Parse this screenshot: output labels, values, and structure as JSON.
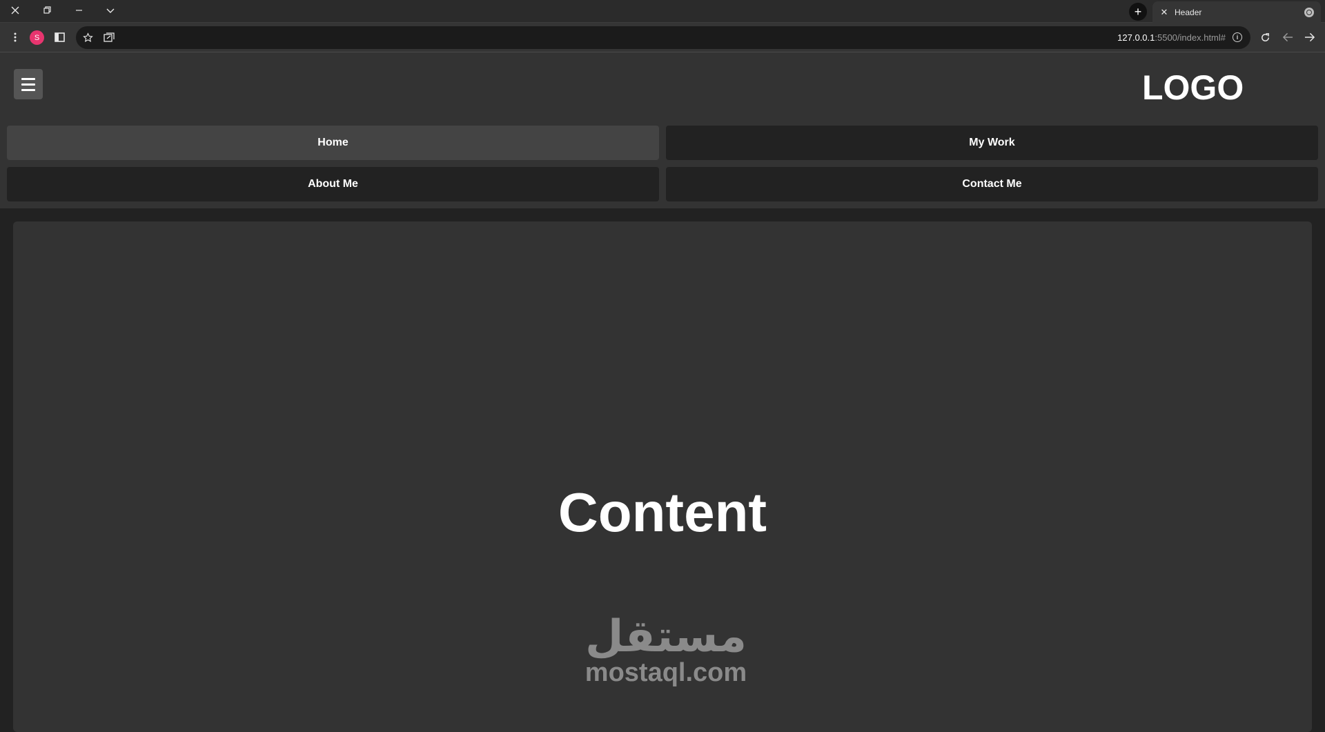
{
  "browser": {
    "tab_title": "Header",
    "url_host": "127.0.0.1",
    "url_rest": ":5500/index.html#",
    "profile_initial": "S",
    "icons": [
      "close-icon",
      "restore-icon",
      "minimize-icon",
      "chevron-down-icon",
      "new-tab-icon",
      "more-icon",
      "sidebar-icon",
      "star-icon",
      "extension-icon",
      "info-icon",
      "reload-icon",
      "back-icon",
      "forward-icon"
    ]
  },
  "header": {
    "logo": "LOGO",
    "menu_icon": "hamburger-icon"
  },
  "nav": {
    "items": [
      {
        "label": "Home",
        "active": true
      },
      {
        "label": "My Work",
        "active": false
      },
      {
        "label": "About Me",
        "active": false
      },
      {
        "label": "Contact Me",
        "active": false
      }
    ]
  },
  "main": {
    "heading": "Content"
  },
  "watermark": {
    "arabic": "مستقل",
    "latin": "mostaql.com"
  },
  "colors": {
    "page_bg": "#222222",
    "header_bg": "#333333",
    "nav_item_bg": "#222222",
    "nav_active_bg": "#444444",
    "menu_button_bg": "#555555"
  }
}
